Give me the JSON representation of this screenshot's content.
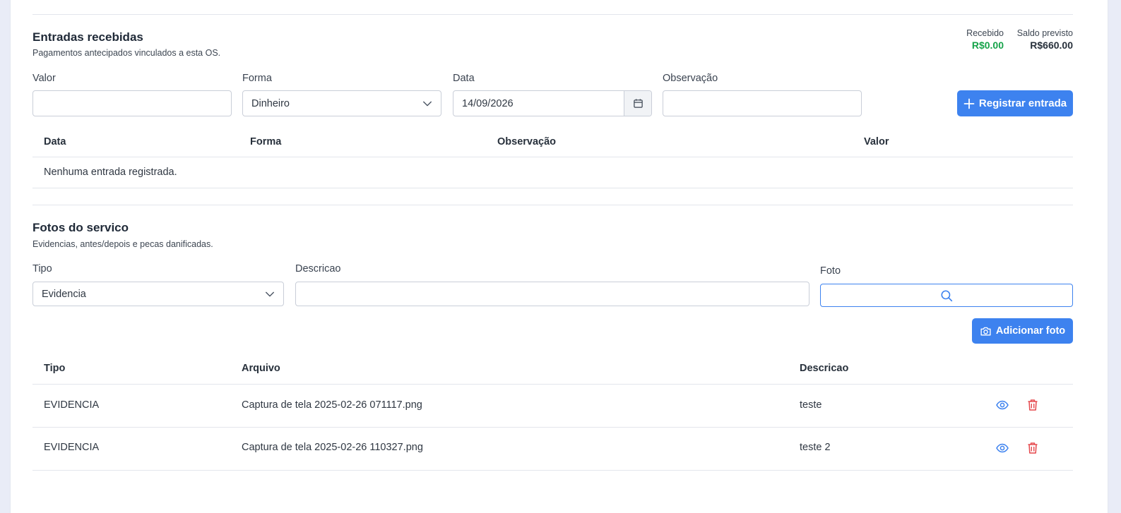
{
  "entradas": {
    "title": "Entradas recebidas",
    "subtitle": "Pagamentos antecipados vinculados a esta OS.",
    "stats": {
      "recebido_label": "Recebido",
      "recebido_value": "R$0.00",
      "saldo_label": "Saldo previsto",
      "saldo_value": "R$660.00"
    },
    "form": {
      "valor_label": "Valor",
      "valor_value": "",
      "forma_label": "Forma",
      "forma_value": "Dinheiro",
      "data_label": "Data",
      "data_value": "14/09/2026",
      "obs_label": "Observação",
      "obs_value": "",
      "submit_label": "Registrar entrada"
    },
    "table": {
      "headers": [
        "Data",
        "Forma",
        "Observação",
        "Valor"
      ],
      "empty_text": "Nenhuma entrada registrada."
    }
  },
  "fotos": {
    "title": "Fotos do servico",
    "subtitle": "Evidencias, antes/depois e pecas danificadas.",
    "form": {
      "tipo_label": "Tipo",
      "tipo_value": "Evidencia",
      "descricao_label": "Descricao",
      "descricao_value": "",
      "foto_label": "Foto",
      "submit_label": "Adicionar foto"
    },
    "table": {
      "headers": [
        "Tipo",
        "Arquivo",
        "Descricao"
      ],
      "rows": [
        {
          "tipo": "EVIDENCIA",
          "arquivo": "Captura de tela 2025-02-26 071117.png",
          "descricao": "teste"
        },
        {
          "tipo": "EVIDENCIA",
          "arquivo": "Captura de tela 2025-02-26 110327.png",
          "descricao": "teste 2"
        }
      ]
    }
  },
  "colors": {
    "primary": "#3d82ef",
    "success": "#16a34a",
    "danger": "#e5484d"
  },
  "icons": [
    "plus-icon",
    "calendar-icon",
    "chevron-down-icon",
    "search-icon",
    "camera-icon",
    "eye-icon",
    "trash-icon"
  ]
}
